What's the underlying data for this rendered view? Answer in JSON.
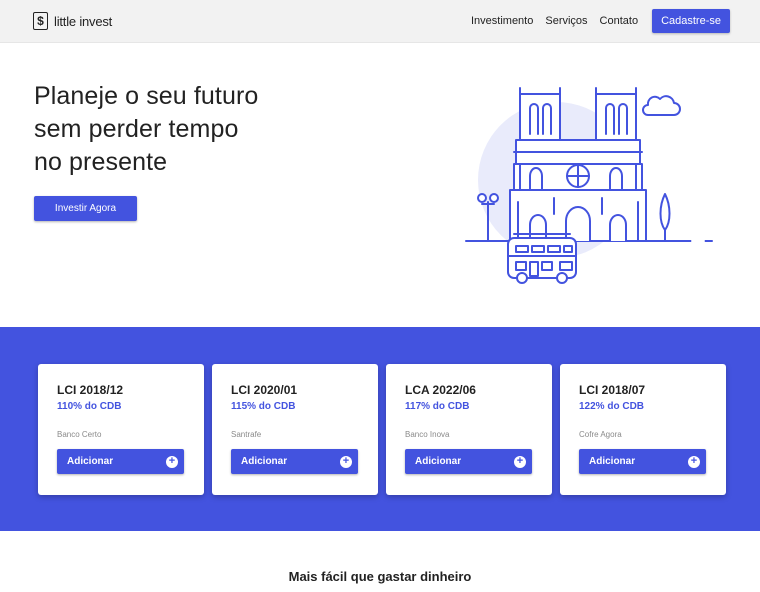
{
  "brand": {
    "icon_symbol": "$",
    "icon": "dollar-sign-icon",
    "name": "little invest"
  },
  "nav": {
    "links": [
      "Investimento",
      "Serviços",
      "Contato"
    ],
    "cta": "Cadastre-se"
  },
  "hero": {
    "title_lines": [
      "Planeje o seu futuro",
      "sem perder tempo",
      "no presente"
    ],
    "cta": "Investir Agora",
    "illustration": "cathedral-city-bus-illustration"
  },
  "offers": [
    {
      "title": "LCI 2018/12",
      "rate": "110% do CDB",
      "bank": "Banco Certo",
      "action": "Adicionar",
      "action_icon": "plus-circle-icon"
    },
    {
      "title": "LCI 2020/01",
      "rate": "115% do CDB",
      "bank": "Santrafe",
      "action": "Adicionar",
      "action_icon": "plus-circle-icon"
    },
    {
      "title": "LCA 2022/06",
      "rate": "117% do CDB",
      "bank": "Banco Inova",
      "action": "Adicionar",
      "action_icon": "plus-circle-icon"
    },
    {
      "title": "LCI 2018/07",
      "rate": "122% do CDB",
      "bank": "Cofre Agora",
      "action": "Adicionar",
      "action_icon": "plus-circle-icon"
    }
  ],
  "section": {
    "title": "Mais fácil que gastar dinheiro"
  },
  "colors": {
    "accent": "#4353df",
    "navbar_bg": "#f2f2f2",
    "illustration_circle": "#e9ebfb"
  }
}
